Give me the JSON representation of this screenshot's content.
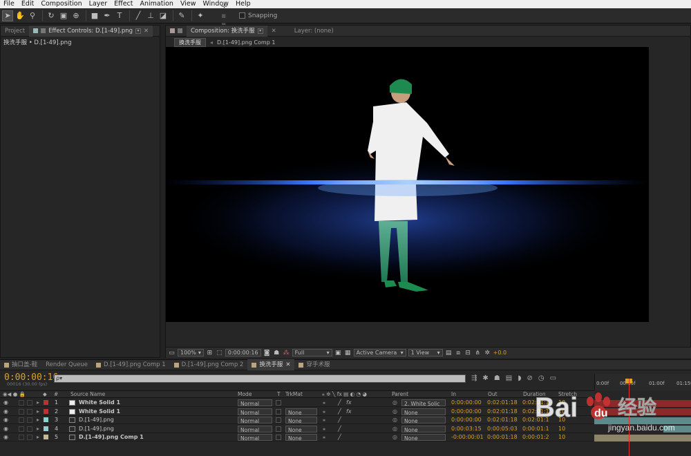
{
  "menu": [
    "File",
    "Edit",
    "Composition",
    "Layer",
    "Effect",
    "Animation",
    "View",
    "Window",
    "Help"
  ],
  "toolbar": {
    "snapping_label": "Snapping"
  },
  "left_panel": {
    "tabs": [
      "Project",
      "Effect Controls: D.[1-49].png"
    ],
    "subtitle": "换洗手服 • D.[1-49].png"
  },
  "comp_panel": {
    "tab_label": "Composition: 换洗手服",
    "layer_tab": "Layer: (none)",
    "breadcrumbs": [
      "换洗手服",
      "D.[1-49].png Comp 1"
    ],
    "controls": {
      "zoom": "100%",
      "timecode": "0:00:00:16",
      "resolution": "Full",
      "camera": "Active Camera",
      "views": "1 View",
      "exposure": "+0.0"
    }
  },
  "timeline": {
    "tabs": [
      "抽口盖-鞋",
      "Render Queue",
      "D.[1-49].png Comp 1",
      "D.[1-49].png Comp 2",
      "换洗手服",
      "穿手术服"
    ],
    "active_tab": 4,
    "timecode": "0:00:00:16",
    "fps": "00016 (30.00 fps)",
    "search_glyph": "ρ▾",
    "headers": {
      "num": "#",
      "source": "Source Name",
      "mode": "Mode",
      "t": "T",
      "trkmat": "TrkMat",
      "parent": "Parent",
      "in": "In",
      "out": "Out",
      "duration": "Duration",
      "stretch": "Stretch"
    },
    "ruler": [
      "0:00f",
      "00:15f",
      "01:00f",
      "01:15f"
    ],
    "layers": [
      {
        "num": "1",
        "name": "White Solid 1",
        "color": "#c03030",
        "mode": "Normal",
        "trkmat": "",
        "parent": "2. White Solic",
        "in": "0:00:00:00",
        "out": "0:02:01:18",
        "duration": "0:02:01:1",
        "stretch": "10",
        "fx": true
      },
      {
        "num": "2",
        "name": "White Solid 1",
        "color": "#c03030",
        "mode": "Normal",
        "trkmat": "None",
        "parent": "None",
        "in": "0:00:00:00",
        "out": "0:02:01:18",
        "duration": "0:02:01:1",
        "stretch": "10",
        "fx": true
      },
      {
        "num": "3",
        "name": "D.[1-49].png",
        "color": "#8fd0d0",
        "mode": "Normal",
        "trkmat": "None",
        "parent": "None",
        "in": "0:00:00:00",
        "out": "0:02:01:18",
        "duration": "0:02:01:1",
        "stretch": "10",
        "fx": false
      },
      {
        "num": "4",
        "name": "D.[1-49].png",
        "color": "#8fd0d0",
        "mode": "Normal",
        "trkmat": "None",
        "parent": "None",
        "in": "0:00:03:15",
        "out": "0:00:05:03",
        "duration": "0:00:01:1",
        "stretch": "10",
        "fx": false
      },
      {
        "num": "5",
        "name": "D.[1-49].png Comp 1",
        "color": "#c8b890",
        "mode": "Normal",
        "trkmat": "None",
        "parent": "None",
        "in": "-0:00:00:01",
        "out": "0:00:01:18",
        "duration": "0:00:01:2",
        "stretch": "10",
        "fx": false
      }
    ]
  },
  "watermark": {
    "brand": "Bai",
    "paw": "du",
    "cn": "经验",
    "url": "jingyan.baidu.com"
  },
  "colors": {
    "timecode": "#e0a020",
    "accent_gold": "#d9a12a",
    "red_label": "#c03030",
    "cyan_label": "#8fd0d0"
  }
}
